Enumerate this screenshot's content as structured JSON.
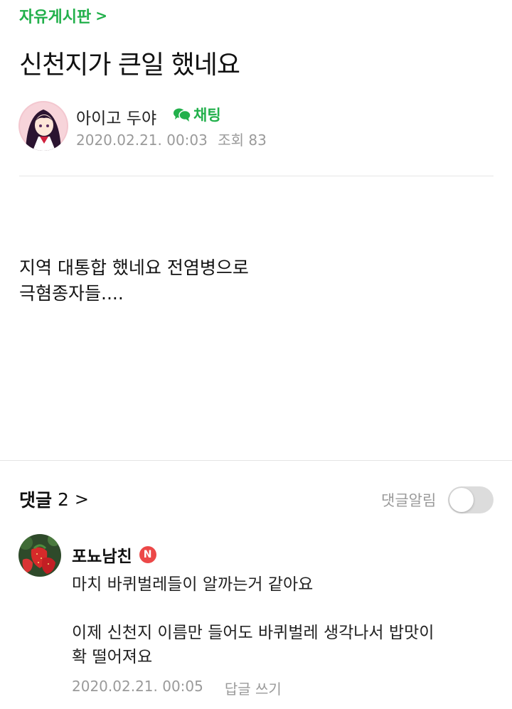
{
  "board": {
    "name": "자유게시판",
    "chevron": ">"
  },
  "post": {
    "title": "신천지가 큰일 했네요",
    "author": "아이고 두야",
    "chat_label": "채팅",
    "date": "2020.02.21. 00:03",
    "views": "조회 83",
    "body_lines": [
      "지역 대통합 했네요 전염병으로",
      "극혐종자들...."
    ]
  },
  "comments_section": {
    "label": "댓글",
    "count": "2",
    "chevron": ">",
    "notify_label": "댓글알림",
    "notify_on": false
  },
  "comment": {
    "author": "포뇨남친",
    "badge": "N",
    "lines": [
      "마치 바퀴벌레들이 알까는거 같아요",
      "",
      "이제 신천지 이름만 들어도 바퀴벌레 생각나서 밥맛이",
      "확 떨어져요"
    ],
    "date": "2020.02.21. 00:05",
    "reply_label": "답글 쓰기"
  },
  "colors": {
    "accent_green": "#22b04b",
    "meta_gray": "#9a9a9a",
    "badge_red": "#ec4848",
    "toggle_off": "#dcdcdc"
  },
  "icons": {
    "chat": "chat-bubbles-icon",
    "chevron": "chevron-right-icon"
  }
}
